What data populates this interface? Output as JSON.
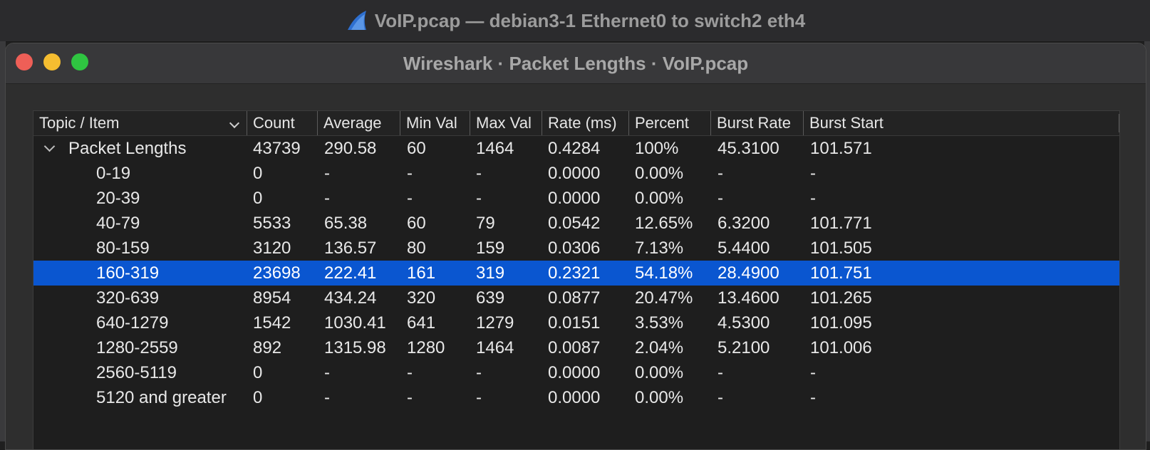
{
  "window": {
    "title": "VoIP.pcap — debian3-1 Ethernet0 to switch2 eth4"
  },
  "dialog": {
    "title": "Wireshark · Packet Lengths · VoIP.pcap"
  },
  "table": {
    "columns": [
      "Topic / Item",
      "Count",
      "Average",
      "Min Val",
      "Max Val",
      "Rate (ms)",
      "Percent",
      "Burst Rate",
      "Burst Start"
    ],
    "rows": [
      [
        "Packet Lengths",
        "43739",
        "290.58",
        "60",
        "1464",
        "0.4284",
        "100%",
        "45.3100",
        "101.571"
      ],
      [
        "0-19",
        "0",
        "-",
        "-",
        "-",
        "0.0000",
        "0.00%",
        "-",
        "-"
      ],
      [
        "20-39",
        "0",
        "-",
        "-",
        "-",
        "0.0000",
        "0.00%",
        "-",
        "-"
      ],
      [
        "40-79",
        "5533",
        "65.38",
        "60",
        "79",
        "0.0542",
        "12.65%",
        "6.3200",
        "101.771"
      ],
      [
        "80-159",
        "3120",
        "136.57",
        "80",
        "159",
        "0.0306",
        "7.13%",
        "5.4400",
        "101.505"
      ],
      [
        "160-319",
        "23698",
        "222.41",
        "161",
        "319",
        "0.2321",
        "54.18%",
        "28.4900",
        "101.751"
      ],
      [
        "320-639",
        "8954",
        "434.24",
        "320",
        "639",
        "0.0877",
        "20.47%",
        "13.4600",
        "101.265"
      ],
      [
        "640-1279",
        "1542",
        "1030.41",
        "641",
        "1279",
        "0.0151",
        "3.53%",
        "4.5300",
        "101.095"
      ],
      [
        "1280-2559",
        "892",
        "1315.98",
        "1280",
        "1464",
        "0.0087",
        "2.04%",
        "5.2100",
        "101.006"
      ],
      [
        "2560-5119",
        "0",
        "-",
        "-",
        "-",
        "0.0000",
        "0.00%",
        "-",
        "-"
      ],
      [
        "5120 and greater",
        "0",
        "-",
        "-",
        "-",
        "0.0000",
        "0.00%",
        "-",
        "-"
      ]
    ],
    "selected_row": 5
  },
  "icons": {
    "app": "wireshark-fin-icon",
    "sort": "chevron-down-icon",
    "expander": "chevron-down-icon"
  },
  "colors": {
    "selection": "#0a56d0",
    "close": "#ee5f57",
    "minimize": "#f5bd30",
    "maximize": "#2fc541"
  }
}
